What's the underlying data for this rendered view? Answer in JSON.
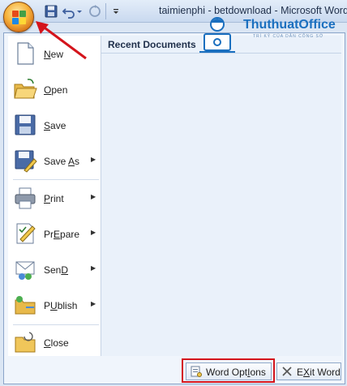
{
  "window": {
    "title": "taimienphi - betdownload - Microsoft Word"
  },
  "watermark": {
    "name": "ThuthuatOffice",
    "tagline": "TRÍ KỶ CỦA DÂN CÔNG SỞ"
  },
  "quick_access": {
    "icons": [
      "save-icon",
      "undo-icon",
      "redo-icon",
      "customize-icon"
    ]
  },
  "office_button": {
    "icon": "office-logo-icon"
  },
  "menu": {
    "recent_heading": "Recent Documents",
    "items": [
      {
        "label": "New",
        "accel": "N",
        "rest": "ew",
        "icon": "new-document-icon",
        "submenu": false
      },
      {
        "label": "Open",
        "accel": "O",
        "rest": "pen",
        "icon": "open-folder-icon",
        "submenu": false
      },
      {
        "label": "Save",
        "accel": "S",
        "rest": "ave",
        "icon": "save-icon",
        "submenu": false
      },
      {
        "label": "Save As",
        "accel": "A",
        "before": "Save ",
        "rest": "s",
        "icon": "save-as-icon",
        "submenu": true
      },
      {
        "label": "Print",
        "accel": "P",
        "rest": "rint",
        "icon": "printer-icon",
        "submenu": true
      },
      {
        "label": "Prepare",
        "accel": "E",
        "before": "Pr",
        "rest": "pare",
        "icon": "prepare-icon",
        "submenu": true
      },
      {
        "label": "Send",
        "accel": "D",
        "before": "Sen",
        "rest": "",
        "icon": "send-icon",
        "submenu": true
      },
      {
        "label": "Publish",
        "accel": "U",
        "before": "P",
        "rest": "blish",
        "icon": "publish-icon",
        "submenu": true
      },
      {
        "label": "Close",
        "accel": "C",
        "rest": "lose",
        "icon": "close-folder-icon",
        "submenu": false
      }
    ],
    "buttons": {
      "word_options": {
        "label": "Word Options",
        "accel": "I",
        "before": "Word Opt",
        "rest": "ons"
      },
      "exit_word": {
        "label": "Exit Word",
        "accel": "X",
        "before": "E",
        "rest": "it Word"
      }
    }
  },
  "colors": {
    "highlight_red": "#d4141c",
    "arrow_red": "#d4141c",
    "brand_blue": "#1a6fbf"
  }
}
